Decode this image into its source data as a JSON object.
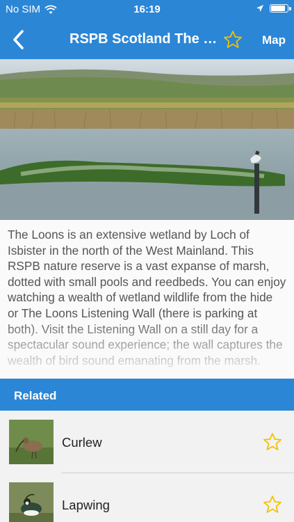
{
  "status_bar": {
    "carrier": "No SIM",
    "time": "16:19",
    "battery_level": 0.92
  },
  "nav": {
    "back_icon": "chevron-left-icon",
    "title": "RSPB Scotland The Loons",
    "favorite_icon": "star-outline-icon",
    "map_label": "Map"
  },
  "description": "The Loons is an extensive wetland by Loch of Isbister in the north of the West Mainland. This RSPB nature reserve is a vast expanse of marsh, dotted with small pools and reedbeds. You can enjoy watching a wealth of wetland wildlife from the hide or The Loons Listening Wall (there is parking at both). Visit the Listening Wall on a still day for a spectacular sound experience; the wall captures the wealth of bird sound emanating from the marsh.",
  "related": {
    "header": "Related",
    "items": [
      {
        "name": "Curlew",
        "icon": "star-outline-icon"
      },
      {
        "name": "Lapwing",
        "icon": "star-outline-icon"
      }
    ]
  },
  "colors": {
    "primary": "#2b86d6",
    "star": "#f2c200"
  }
}
